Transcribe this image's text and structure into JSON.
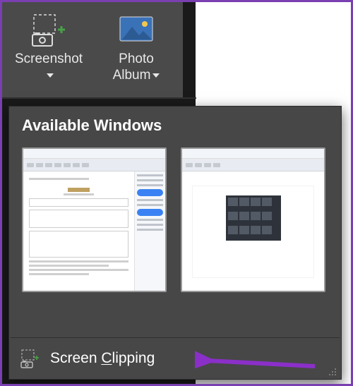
{
  "ribbon": {
    "screenshot_label": "Screenshot",
    "photo_album_label_line1": "Photo",
    "photo_album_label_line2": "Album"
  },
  "dropdown": {
    "header": "Available Windows",
    "action_prefix": "Screen ",
    "action_hotkey": "C",
    "action_suffix": "lipping"
  },
  "colors": {
    "accent_purple": "#8b2fc9",
    "plus_green": "#48a047"
  }
}
